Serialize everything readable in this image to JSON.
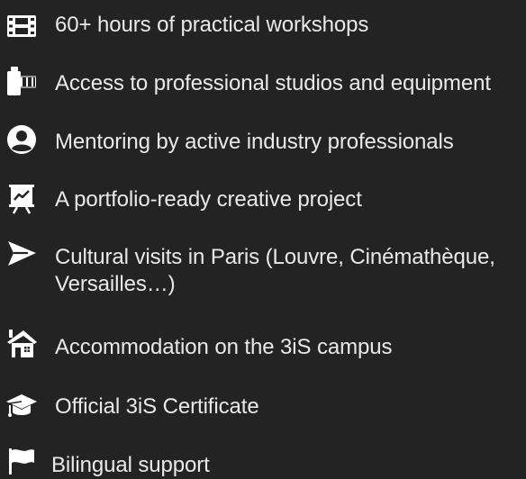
{
  "features": [
    {
      "icon": "film-icon",
      "text": "60+ hours of practical workshops"
    },
    {
      "icon": "camera-film-icon",
      "text": "Access to professional studios and equipment"
    },
    {
      "icon": "user-circle-icon",
      "text": "Mentoring by active industry professionals"
    },
    {
      "icon": "presentation-chart-icon",
      "text": "A portfolio-ready creative project"
    },
    {
      "icon": "paper-plane-icon",
      "text": "Cultural visits in Paris (Louvre, Cinémathèque, Versailles…)"
    },
    {
      "icon": "house-icon",
      "text": "Accommodation on the 3iS campus"
    },
    {
      "icon": "graduation-cap-icon",
      "text": "Official 3iS Certificate"
    },
    {
      "icon": "flag-icon",
      "text": "Bilingual support"
    }
  ],
  "colors": {
    "background": "#232323",
    "text": "#e9e9e9",
    "icon": "#ffffff"
  }
}
